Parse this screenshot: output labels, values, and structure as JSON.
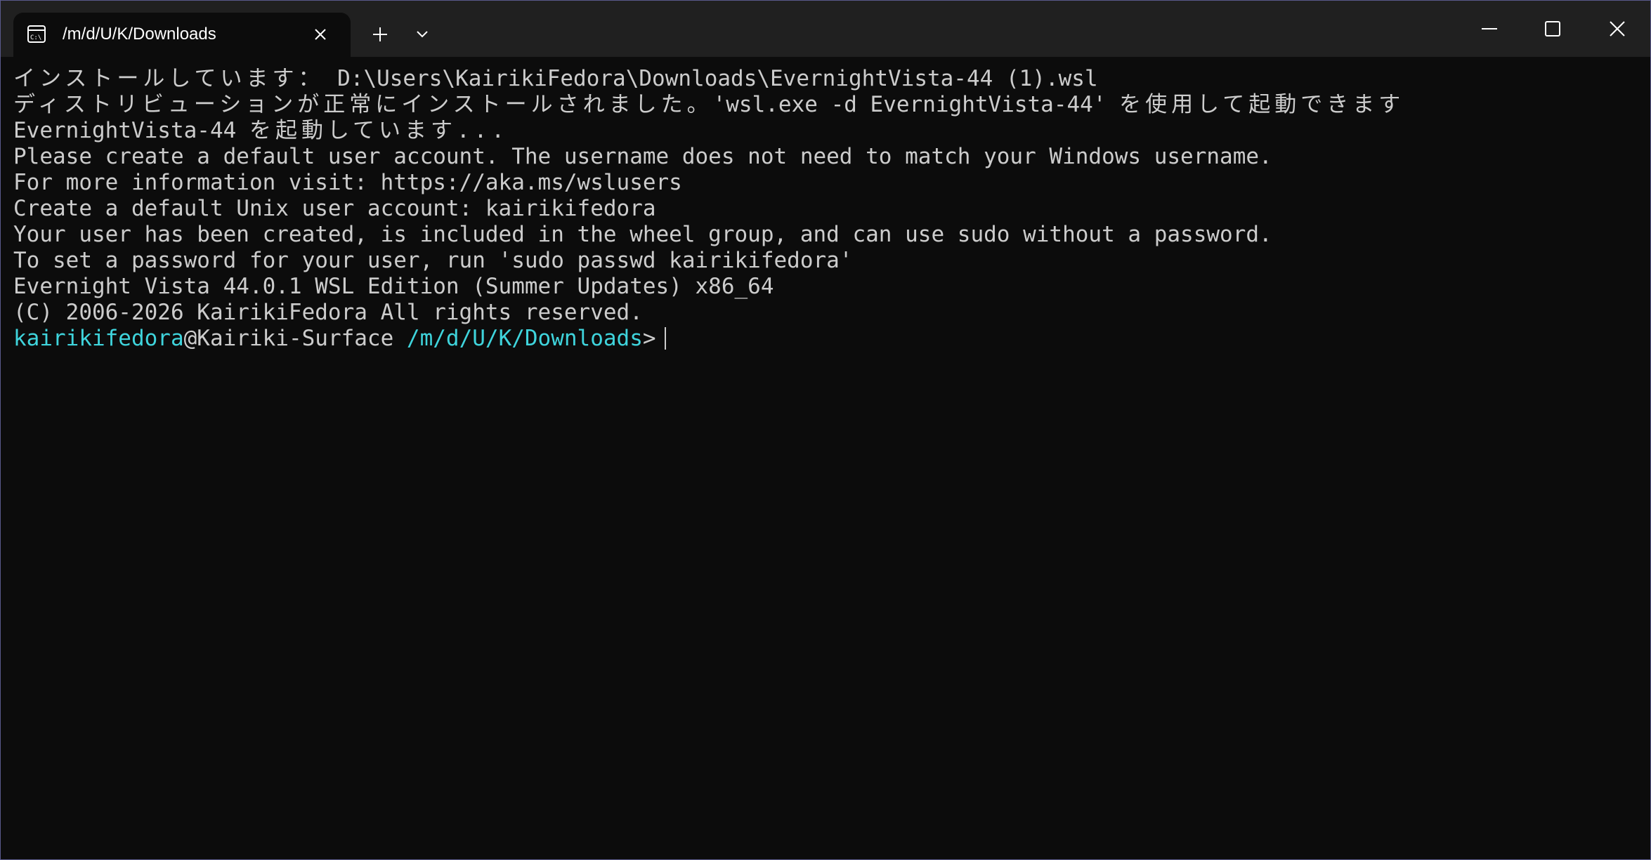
{
  "tab": {
    "title": "/m/d/U/K/Downloads",
    "icon": "terminal-icon"
  },
  "titlebar": {
    "new_tab_icon": "plus-icon",
    "dropdown_icon": "chevron-down-icon",
    "minimize_icon": "minimize-icon",
    "maximize_icon": "maximize-icon",
    "close_icon": "close-icon"
  },
  "terminal": {
    "lines": [
      {
        "jp": "インストールしています：",
        "rest": " D:\\Users\\KairikiFedora\\Downloads\\EvernightVista-44 (1).wsl"
      },
      {
        "jp": "ディストリビューションが正常にインストールされました。",
        "mid": "'wsl.exe -d EvernightVista-44' ",
        "jp2": "を使用して起動できます"
      },
      {
        "pre": "EvernightVista-44 ",
        "jp": "を起動しています..."
      },
      {
        "text": "Please create a default user account. The username does not need to match your Windows username."
      },
      {
        "text": "For more information visit: https://aka.ms/wslusers"
      },
      {
        "text": "Create a default Unix user account: kairikifedora"
      },
      {
        "text": "Your user has been created, is included in the wheel group, and can use sudo without a password."
      },
      {
        "text": "To set a password for your user, run 'sudo passwd kairikifedora'"
      },
      {
        "text": "Evernight Vista 44.0.1 WSL Edition (Summer Updates) x86_64"
      },
      {
        "text": "(C) 2006-2026 KairikiFedora All rights reserved."
      }
    ],
    "prompt": {
      "user": "kairikifedora",
      "host": "@Kairiki-Surface ",
      "path": "/m/d/U/K/Downloads",
      "symbol": ">"
    }
  },
  "colors": {
    "background": "#0c0c0c",
    "titlebar": "#202020",
    "text": "#cccccc",
    "accent": "#3fd4dc"
  }
}
